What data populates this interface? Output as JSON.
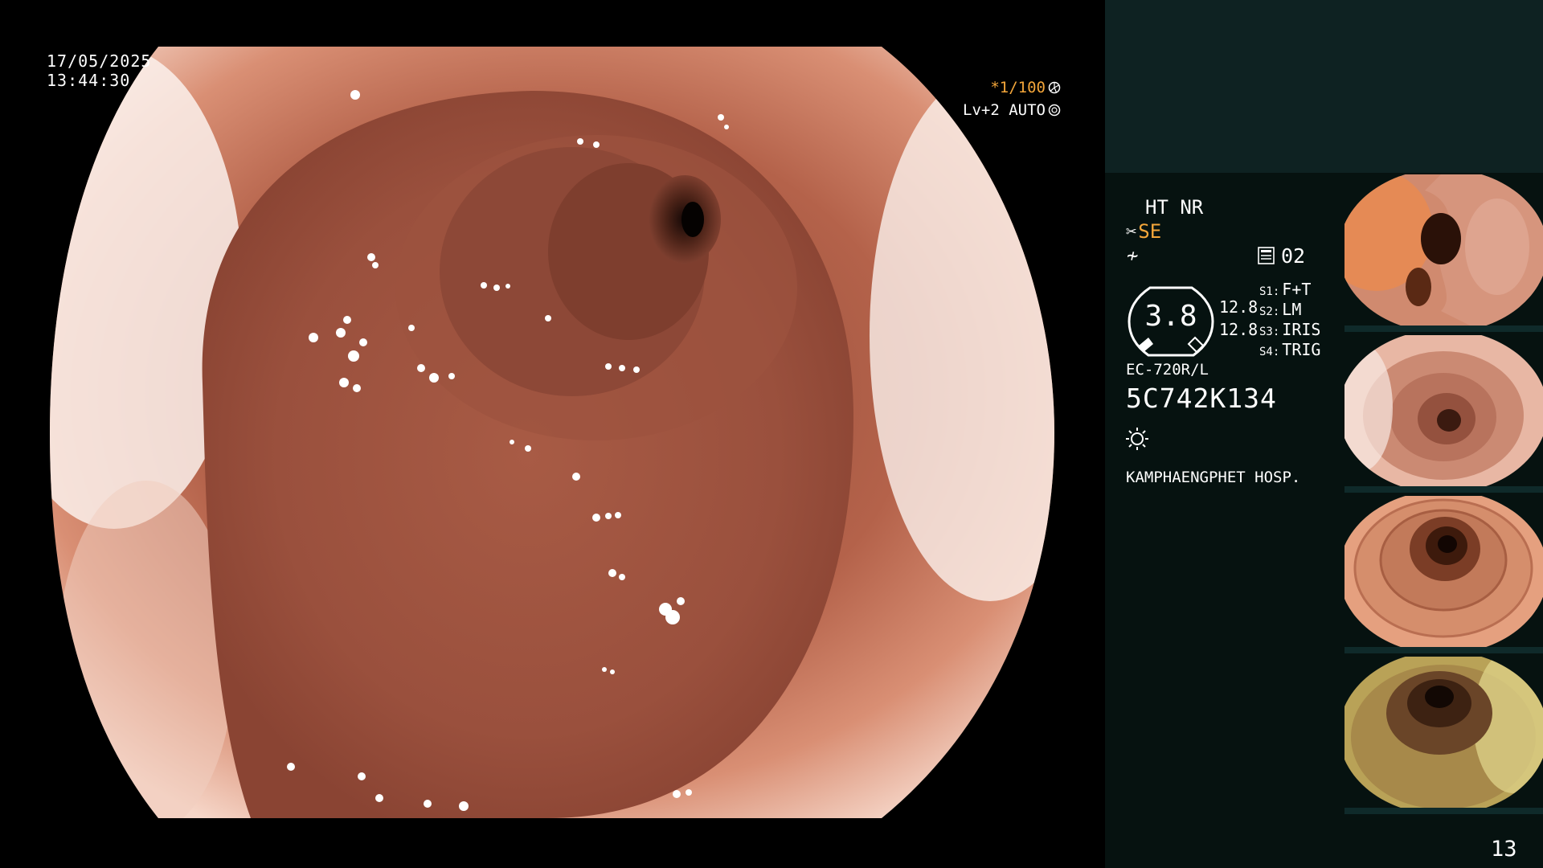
{
  "overlay": {
    "date": "17/05/2025",
    "time": "13:44:30",
    "shutter": "*1/100",
    "level": "Lv+2 AUTO"
  },
  "panel": {
    "mode_line": "HT NR",
    "structure_mode": "SE",
    "memory_number": "02",
    "gauge_value": "3.8",
    "value_1": "12.8",
    "value_2": "12.8",
    "switches": [
      {
        "key": "S1:",
        "label": "F+T"
      },
      {
        "key": "S2:",
        "label": "LM"
      },
      {
        "key": "S3:",
        "label": "IRIS"
      },
      {
        "key": "S4:",
        "label": "TRIG"
      }
    ],
    "model": "EC-720R/L",
    "serial": "5C742K134",
    "hospital": "KAMPHAENGPHET HOSP."
  },
  "page_number": "13",
  "colors": {
    "accent_orange": "#f4a63a",
    "panel_bg": "#061210",
    "panel_top_bg": "#0e2222",
    "mucosa": "#a65a44"
  },
  "icons": [
    "shutter-ring-icon",
    "auto-ring-icon",
    "scissor-icon",
    "filter-icon",
    "memo-icon",
    "gauge-icon",
    "sun-icon"
  ]
}
